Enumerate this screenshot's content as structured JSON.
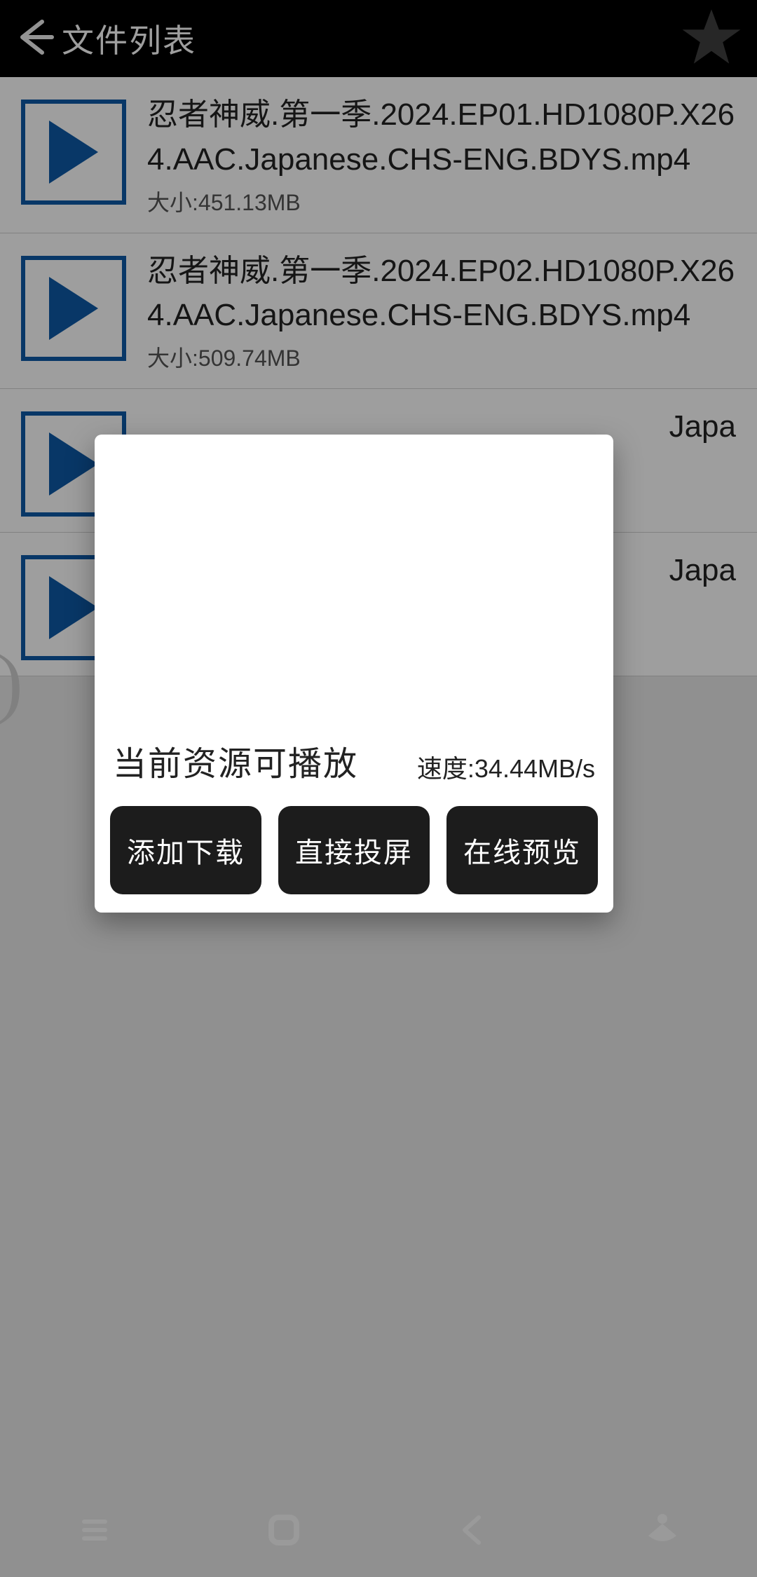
{
  "header": {
    "title": "文件列表"
  },
  "files": [
    {
      "name": "忍者神威.第一季.2024.EP01.HD1080P.X264.AAC.Japanese.CHS-ENG.BDYS.mp4",
      "size": "大小:451.13MB"
    },
    {
      "name": "忍者神威.第一季.2024.EP02.HD1080P.X264.AAC.Japanese.CHS-ENG.BDYS.mp4",
      "size": "大小:509.74MB"
    },
    {
      "name": "Japa",
      "size": ""
    },
    {
      "name": "Japa",
      "size": ""
    }
  ],
  "dialog": {
    "playable_label": "当前资源可播放",
    "speed_label": "速度:34.44MB/s",
    "buttons": {
      "add_download": "添加下载",
      "cast": "直接投屏",
      "preview": "在线预览"
    }
  }
}
